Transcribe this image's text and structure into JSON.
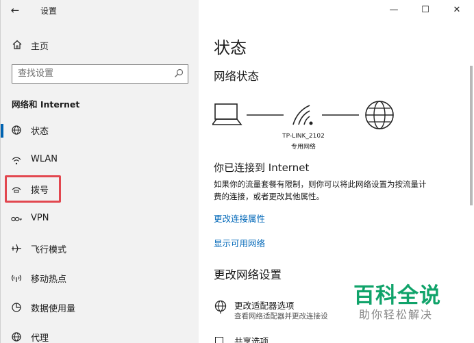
{
  "window": {
    "title": "设置",
    "back_glyph": "←",
    "controls": {
      "minimize": "—",
      "maximize": "☐",
      "close": "✕"
    }
  },
  "sidebar": {
    "home_label": "主页",
    "search_placeholder": "查找设置",
    "group_title": "网络和 Internet",
    "items": [
      {
        "label": "状态",
        "icon": "globe-icon",
        "active": true
      },
      {
        "label": "WLAN",
        "icon": "wifi-icon"
      },
      {
        "label": "拨号",
        "icon": "dialup-icon",
        "highlighted": true
      },
      {
        "label": "VPN",
        "icon": "vpn-icon"
      },
      {
        "label": "飞行模式",
        "icon": "airplane-icon"
      },
      {
        "label": "移动热点",
        "icon": "hotspot-icon"
      },
      {
        "label": "数据使用量",
        "icon": "data-usage-icon"
      },
      {
        "label": "代理",
        "icon": "globe-icon"
      }
    ]
  },
  "main": {
    "title": "状态",
    "network_status_title": "网络状态",
    "network_name": "TP-LINK_2102",
    "network_type": "专用网络",
    "connected_text": "你已连接到 Internet",
    "description_line1": "如果你的流量套餐有限制，则你可以将此网络设置为按流量计",
    "description_line2": "费的连接，或者更改其他属性。",
    "link_change_properties": "更改连接属性",
    "link_show_networks": "显示可用网络",
    "change_settings_title": "更改网络设置",
    "adapter_title": "更改适配器选项",
    "adapter_desc": "查看网络适配器并更改连接设",
    "share_title": "共享选项"
  },
  "watermark": {
    "line1": "百科全说",
    "line2": "助你轻松解决"
  },
  "colors": {
    "accent": "#0063b1",
    "link": "#0067b8",
    "highlight": "#e2474f",
    "watermark_green": "#10a36a"
  }
}
